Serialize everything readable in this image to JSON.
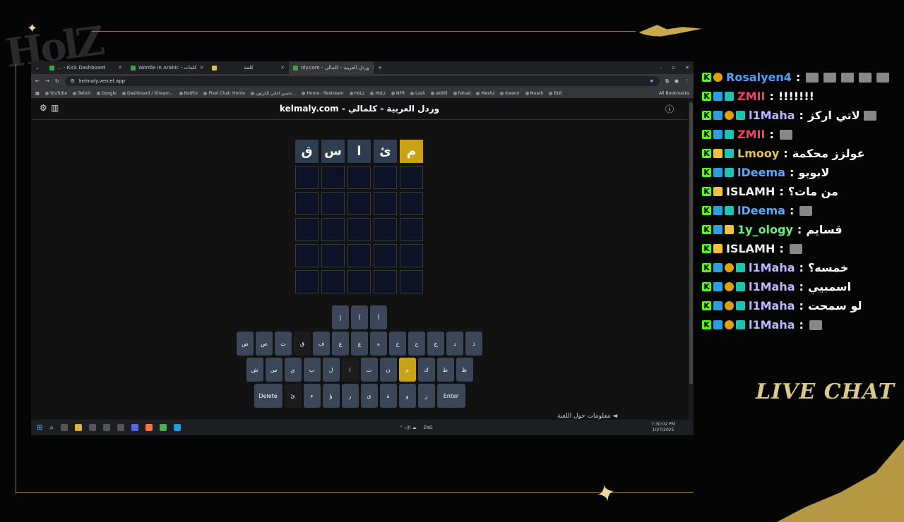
{
  "browser": {
    "tabs": [
      {
        "label": "... - Kick Dashboard",
        "active": false
      },
      {
        "label": "Wordle in Arabic - كلمات",
        "active": false
      },
      {
        "label": "كلمة",
        "active": false
      },
      {
        "label": "nly.com - وردل العربية - كلمالي",
        "active": true
      }
    ],
    "new_tab": "+",
    "url": "kelmaly.vercel.app",
    "bookmarks": [
      "YouTube",
      "Twitch",
      "Google",
      "Dashboard / Stream...",
      "BotRix",
      "Pixel Chat: Home",
      "تخمين اغاني الكرتون...",
      "Home - Restream",
      "HoLz",
      "HoLz",
      "NFR",
      "Lush",
      "ak90l",
      "Fahad",
      "Meshz",
      "Kwenn",
      "Muath",
      "BLB"
    ],
    "all_bookmarks": "All Bookmarks"
  },
  "game": {
    "title": "kelmaly.com - وردل العربية - كلمالي",
    "grid": [
      [
        {
          "l": "ق",
          "s": "filled"
        },
        {
          "l": "س",
          "s": "filled"
        },
        {
          "l": "ا",
          "s": "filled"
        },
        {
          "l": "ئ",
          "s": "filled"
        },
        {
          "l": "م",
          "s": "present"
        }
      ],
      [
        {
          "l": "",
          "s": "empty"
        },
        {
          "l": "",
          "s": "empty"
        },
        {
          "l": "",
          "s": "empty"
        },
        {
          "l": "",
          "s": "empty"
        },
        {
          "l": "",
          "s": "empty"
        }
      ],
      [
        {
          "l": "",
          "s": "empty"
        },
        {
          "l": "",
          "s": "empty"
        },
        {
          "l": "",
          "s": "empty"
        },
        {
          "l": "",
          "s": "empty"
        },
        {
          "l": "",
          "s": "empty"
        }
      ],
      [
        {
          "l": "",
          "s": "empty"
        },
        {
          "l": "",
          "s": "empty"
        },
        {
          "l": "",
          "s": "empty"
        },
        {
          "l": "",
          "s": "empty"
        },
        {
          "l": "",
          "s": "empty"
        }
      ],
      [
        {
          "l": "",
          "s": "empty"
        },
        {
          "l": "",
          "s": "empty"
        },
        {
          "l": "",
          "s": "empty"
        },
        {
          "l": "",
          "s": "empty"
        },
        {
          "l": "",
          "s": "empty"
        }
      ],
      [
        {
          "l": "",
          "s": "empty"
        },
        {
          "l": "",
          "s": "empty"
        },
        {
          "l": "",
          "s": "empty"
        },
        {
          "l": "",
          "s": "empty"
        },
        {
          "l": "",
          "s": "empty"
        }
      ]
    ],
    "keyboard": [
      [
        {
          "k": "إ"
        },
        {
          "k": "آ"
        },
        {
          "k": "أ"
        }
      ],
      [
        {
          "k": "ض"
        },
        {
          "k": "ص"
        },
        {
          "k": "ث"
        },
        {
          "k": "ق",
          "s": "dark"
        },
        {
          "k": "ف"
        },
        {
          "k": "غ"
        },
        {
          "k": "ع"
        },
        {
          "k": "ه"
        },
        {
          "k": "خ"
        },
        {
          "k": "ح"
        },
        {
          "k": "ج"
        },
        {
          "k": "د"
        },
        {
          "k": "ذ"
        }
      ],
      [
        {
          "k": "ش"
        },
        {
          "k": "س"
        },
        {
          "k": "ي"
        },
        {
          "k": "ب"
        },
        {
          "k": "ل"
        },
        {
          "k": "ا",
          "s": "dark"
        },
        {
          "k": "ت"
        },
        {
          "k": "ن"
        },
        {
          "k": "م",
          "s": "present"
        },
        {
          "k": "ك"
        },
        {
          "k": "ط"
        },
        {
          "k": "ظ"
        }
      ],
      [
        {
          "k": "Delete",
          "w": true
        },
        {
          "k": "ئ",
          "s": "dark"
        },
        {
          "k": "ء"
        },
        {
          "k": "ؤ"
        },
        {
          "k": "ر"
        },
        {
          "k": "ى"
        },
        {
          "k": "ة"
        },
        {
          "k": "و"
        },
        {
          "k": "ز"
        },
        {
          "k": "Enter",
          "w": true
        }
      ]
    ],
    "info_link": "معلومات حول اللعبة ◄"
  },
  "taskbar": {
    "lang": "ENG",
    "time": "7:30:02 PM",
    "date": "10/7/2025"
  },
  "chat": {
    "messages": [
      {
        "user": "Rosalyen4",
        "color": "#4aa3ff",
        "badges": [
          "k",
          "flame"
        ],
        "text": "",
        "emotes": 5
      },
      {
        "user": "ZMII",
        "color": "#ff3b5c",
        "badges": [
          "k",
          "sub",
          "og"
        ],
        "text": "!!!!!!!",
        "emotes": 0
      },
      {
        "user": "l1Maha",
        "color": "#b9b9ff",
        "badges": [
          "k",
          "sub",
          "gold",
          "og"
        ],
        "text": "لاتي اركز",
        "emotes": 1
      },
      {
        "user": "ZMII",
        "color": "#ff3b5c",
        "badges": [
          "k",
          "sub",
          "og"
        ],
        "text": "",
        "emotes": 1
      },
      {
        "user": "Lmooy",
        "color": "#e8c34a",
        "badges": [
          "k",
          "star",
          "og"
        ],
        "text": "عولزز محكمة",
        "emotes": 0
      },
      {
        "user": "lDeema",
        "color": "#5aa9ff",
        "badges": [
          "k",
          "sub",
          "og"
        ],
        "text": "لابوبو",
        "emotes": 0
      },
      {
        "user": "ISLAMH",
        "color": "#f0f0f0",
        "badges": [
          "k",
          "crown"
        ],
        "text": "من مات؟",
        "emotes": 0
      },
      {
        "user": "lDeema",
        "color": "#5aa9ff",
        "badges": [
          "k",
          "sub",
          "og"
        ],
        "text": "",
        "emotes": 1
      },
      {
        "user": "1y_ology",
        "color": "#6cf07a",
        "badges": [
          "k",
          "sub",
          "star"
        ],
        "text": "قسايم",
        "emotes": 0
      },
      {
        "user": "ISLAMH",
        "color": "#f0f0f0",
        "badges": [
          "k",
          "crown"
        ],
        "text": "",
        "emotes": 1
      },
      {
        "user": "l1Maha",
        "color": "#b9b9ff",
        "badges": [
          "k",
          "sub",
          "gold",
          "og"
        ],
        "text": "خمسه؟",
        "emotes": 0
      },
      {
        "user": "l1Maha",
        "color": "#b9b9ff",
        "badges": [
          "k",
          "sub",
          "gold",
          "og"
        ],
        "text": "اسمبيي",
        "emotes": 0
      },
      {
        "user": "l1Maha",
        "color": "#b9b9ff",
        "badges": [
          "k",
          "sub",
          "gold",
          "og"
        ],
        "text": "لو سمحت",
        "emotes": 0
      },
      {
        "user": "l1Maha",
        "color": "#b9b9ff",
        "badges": [
          "k",
          "sub",
          "gold",
          "og"
        ],
        "text": "",
        "emotes": 1
      }
    ],
    "live_label": "LIVE CHAT"
  }
}
